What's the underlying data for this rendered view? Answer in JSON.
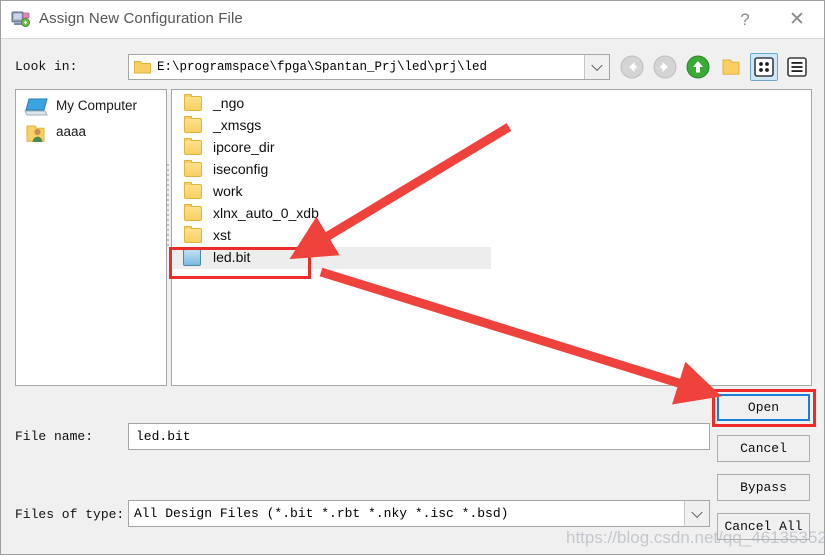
{
  "window": {
    "title": "Assign New Configuration File",
    "icon": "assign-config-icon",
    "help_label": "?",
    "close_label": "✕"
  },
  "lookin": {
    "label": "Look in:",
    "path": "E:\\programspace\\fpga\\Spantan_Prj\\led\\prj\\led",
    "folder_icon": "folder-icon",
    "dropdown_icon": "chevron-down-icon"
  },
  "toolbar": {
    "items": [
      {
        "name": "back-button",
        "icon": "arrow-left-circle-icon",
        "label": "Back",
        "enabled": false
      },
      {
        "name": "forward-button",
        "icon": "arrow-right-circle-icon",
        "label": "Forward",
        "enabled": false
      },
      {
        "name": "parent-directory-button",
        "icon": "arrow-up-circle-icon",
        "label": "Parent Directory",
        "enabled": true
      },
      {
        "name": "new-folder-button",
        "icon": "new-folder-icon",
        "label": "Create New Folder",
        "enabled": true
      },
      {
        "name": "list-view-button",
        "icon": "list-view-icon",
        "label": "List View",
        "selected": true
      },
      {
        "name": "detail-view-button",
        "icon": "detail-view-icon",
        "label": "Detail View",
        "selected": false
      }
    ]
  },
  "sidebar": {
    "items": [
      {
        "label": "My Computer",
        "icon": "computer-icon"
      },
      {
        "label": "aaaa",
        "icon": "user-folder-icon"
      }
    ]
  },
  "filelist": {
    "items": [
      {
        "name": "_ngo",
        "type": "folder"
      },
      {
        "name": "_xmsgs",
        "type": "folder"
      },
      {
        "name": "ipcore_dir",
        "type": "folder"
      },
      {
        "name": "iseconfig",
        "type": "folder"
      },
      {
        "name": "work",
        "type": "folder"
      },
      {
        "name": "xlnx_auto_0_xdb",
        "type": "folder"
      },
      {
        "name": "xst",
        "type": "folder"
      },
      {
        "name": "led.bit",
        "type": "file",
        "selected": true
      }
    ]
  },
  "form": {
    "filename_label": "File name:",
    "filename_value": "led.bit",
    "filetype_label": "Files of type:",
    "filetype_value": "All Design Files (*.bit *.rbt *.nky *.isc *.bsd)",
    "filetype_dropdown_icon": "chevron-down-icon"
  },
  "buttons": {
    "open": "Open",
    "cancel": "Cancel",
    "bypass": "Bypass",
    "cancel_all": "Cancel All"
  },
  "annotations": {
    "highlight_color": "#ee2b2b",
    "arrow_color": "#f0423c",
    "boxes": [
      "led.bit file row",
      "Open button"
    ],
    "arrows": [
      "points to led.bit",
      "points to Open button"
    ]
  },
  "watermark": {
    "text": "https://blog.csdn.net/qq_46135352"
  },
  "colors": {
    "dialog_background": "#f0f0f0",
    "titlebar_background": "#ffffff",
    "field_background": "#ffffff",
    "border": "#a6a6a6",
    "default_button_border": "#1a7fd4",
    "selection_background": "#ededed",
    "folder_yellow": "#f7cf63",
    "accent_green": "#3ba935"
  }
}
